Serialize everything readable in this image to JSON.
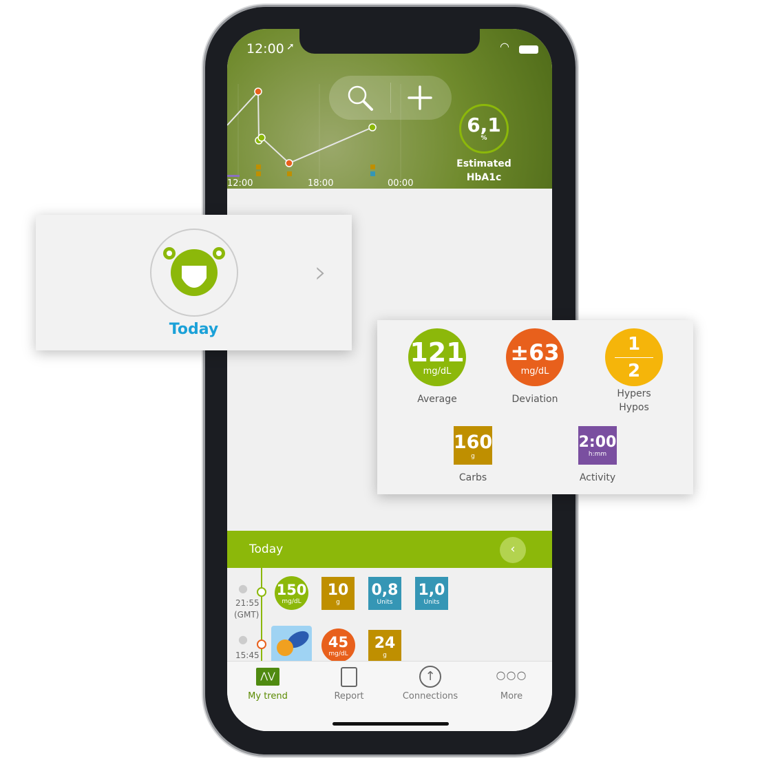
{
  "status": {
    "time": "12:00"
  },
  "header": {
    "chart_times": [
      "12:00",
      "18:00",
      "00:00"
    ],
    "hba1c": {
      "value": "6,1",
      "unit": "%",
      "label1": "Estimated",
      "label2": "HbA1c"
    }
  },
  "today_card": {
    "label": "Today"
  },
  "stats": {
    "average": {
      "value": "121",
      "unit": "mg/dL",
      "label": "Average"
    },
    "deviation": {
      "value": "±63",
      "unit": "mg/dL",
      "label": "Deviation"
    },
    "hypers": {
      "value": "1",
      "label": "Hypers"
    },
    "hypos": {
      "value": "2",
      "label": "Hypos"
    },
    "carbs": {
      "value": "160",
      "unit": "g",
      "label": "Carbs"
    },
    "activity": {
      "value": "2:00",
      "unit": "h:mm",
      "label": "Activity"
    }
  },
  "log": {
    "title": "Today",
    "entries": [
      {
        "time": "21:55",
        "tz": "(GMT)",
        "glucose": "150",
        "glucose_unit": "mg/dL",
        "carbs": "10",
        "carbs_unit": "g",
        "bolus1": "0,8",
        "bolus2": "1,0",
        "units": "Units"
      },
      {
        "time": "15:45",
        "glucose": "45",
        "glucose_unit": "mg/dL",
        "carbs": "24",
        "carbs_unit": "g"
      }
    ]
  },
  "tabs": [
    {
      "label": "My trend"
    },
    {
      "label": "Report"
    },
    {
      "label": "Connections"
    },
    {
      "label": "More"
    }
  ],
  "colors": {
    "green": "#8cb80a",
    "orange": "#e8601c",
    "yellow": "#f5b50a",
    "carbs": "#bf8f00",
    "activity": "#7a4fa0",
    "insulin": "#3596b5",
    "today_blue": "#1ba1d8"
  }
}
